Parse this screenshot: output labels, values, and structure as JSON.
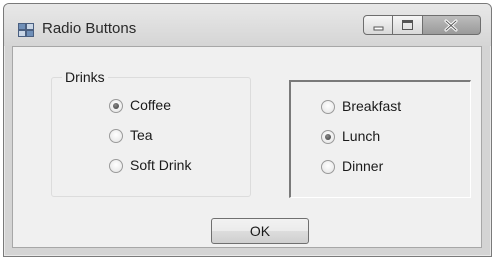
{
  "window": {
    "title": "Radio Buttons",
    "icon": "form-icon",
    "controls": {
      "minimize": "minimize-icon",
      "maximize": "maximize-icon",
      "close": "close-icon"
    }
  },
  "drinks_group": {
    "title": "Drinks",
    "options": [
      {
        "label": "Coffee",
        "checked": true
      },
      {
        "label": "Tea",
        "checked": false
      },
      {
        "label": "Soft Drink",
        "checked": false
      }
    ]
  },
  "meals_panel": {
    "options": [
      {
        "label": "Breakfast",
        "checked": false
      },
      {
        "label": "Lunch",
        "checked": true
      },
      {
        "label": "Dinner",
        "checked": false
      }
    ]
  },
  "ok_button": {
    "label": "OK"
  }
}
